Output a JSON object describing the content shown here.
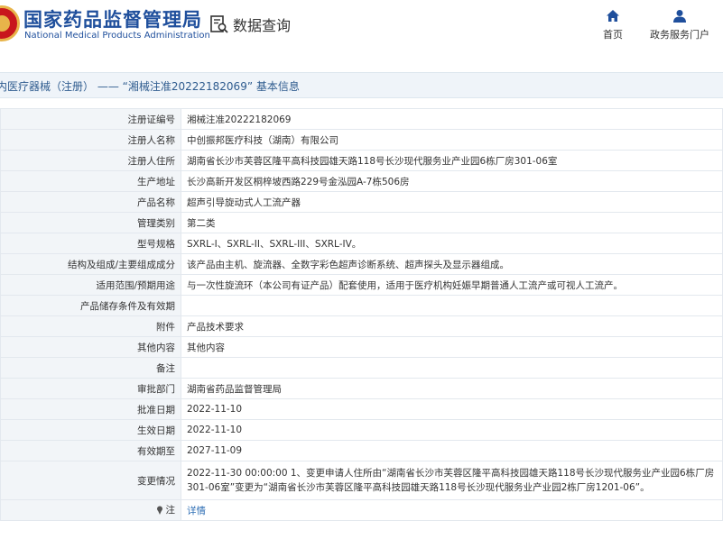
{
  "header": {
    "site_name_cn": "国家药品监督管理局",
    "site_name_en": "National Medical Products Administration",
    "query_title": "数据查询",
    "nav": {
      "home": "首页",
      "portal": "政务服务门户"
    }
  },
  "breadcrumb": "内医疗器械（注册） —— “湘械注准20222182069” 基本信息",
  "rows": [
    {
      "k": "注册证编号",
      "v": "湘械注准20222182069"
    },
    {
      "k": "注册人名称",
      "v": "中创振邦医疗科技（湖南）有限公司"
    },
    {
      "k": "注册人住所",
      "v": "湖南省长沙市芙蓉区隆平高科技园雄天路118号长沙现代服务业产业园6栋厂房301-06室"
    },
    {
      "k": "生产地址",
      "v": "长沙高新开发区桐梓坡西路229号金泓园A-7栋506房"
    },
    {
      "k": "产品名称",
      "v": "超声引导旋动式人工流产器"
    },
    {
      "k": "管理类别",
      "v": "第二类"
    },
    {
      "k": "型号规格",
      "v": "SXRL-I、SXRL-II、SXRL-III、SXRL-IV。"
    },
    {
      "k": "结构及组成/主要组成成分",
      "v": "该产品由主机、旋流器、全数字彩色超声诊断系统、超声探头及显示器组成。"
    },
    {
      "k": "适用范围/预期用途",
      "v": "与一次性旋流环（本公司有证产品）配套使用，适用于医疗机构妊娠早期普通人工流产或可视人工流产。"
    },
    {
      "k": "产品储存条件及有效期",
      "v": ""
    },
    {
      "k": "附件",
      "v": "产品技术要求"
    },
    {
      "k": "其他内容",
      "v": "其他内容"
    },
    {
      "k": "备注",
      "v": ""
    },
    {
      "k": "审批部门",
      "v": "湖南省药品监督管理局"
    },
    {
      "k": "批准日期",
      "v": "2022-11-10"
    },
    {
      "k": "生效日期",
      "v": "2022-11-10"
    },
    {
      "k": "有效期至",
      "v": "2027-11-09"
    },
    {
      "k": "变更情况",
      "v": "2022-11-30 00:00:00 1、变更申请人住所由“湖南省长沙市芙蓉区隆平高科技园雄天路118号长沙现代服务业产业园6栋厂房301-06室”变更为“湖南省长沙市芙蓉区隆平高科技园雄天路118号长沙现代服务业产业园2栋厂房1201-06”。"
    },
    {
      "k": "注",
      "v": "详情"
    }
  ]
}
